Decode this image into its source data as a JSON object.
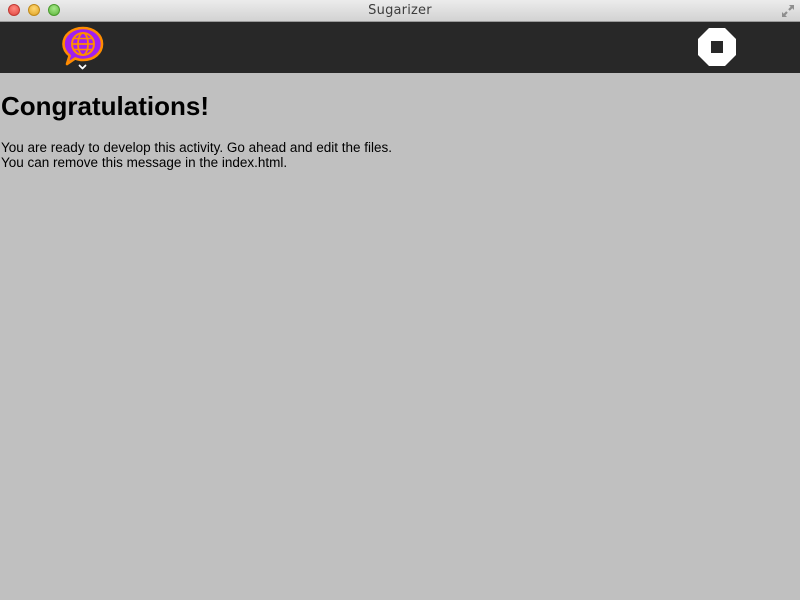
{
  "window": {
    "title": "Sugarizer"
  },
  "toolbar": {
    "activity_icon": "activity-globe-icon",
    "stop_icon": "stop-icon",
    "colors": {
      "background": "#282828",
      "activity_fill": "#a020f0",
      "activity_stroke": "#ff8c00"
    }
  },
  "content": {
    "heading": "Congratulations!",
    "message_line1": "You are ready to develop this activity. Go ahead and edit the files.",
    "message_line2": "You can remove this message in the index.html."
  },
  "colors": {
    "page_background": "#c0c0c0"
  }
}
